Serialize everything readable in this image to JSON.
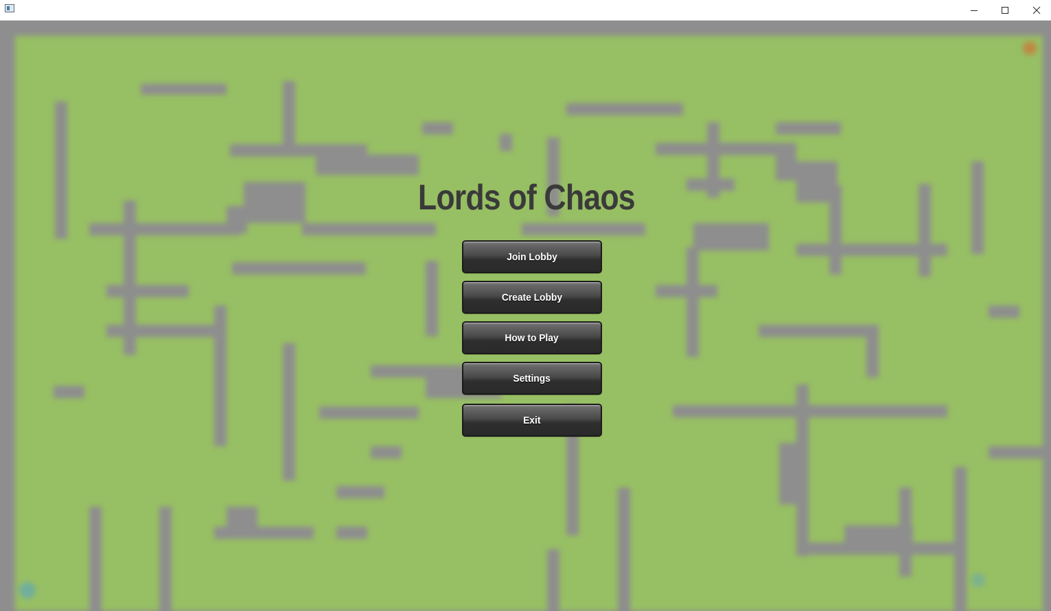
{
  "window": {
    "title": "",
    "controls": [
      "minimize-icon",
      "maximize-icon",
      "close-icon"
    ]
  },
  "game": {
    "title": "Lords of Chaos",
    "background": "blurred maze map",
    "colors": {
      "grass": "#97bf63",
      "wall": "#8e8e8e",
      "title_text": "#3a3a3a",
      "button_dark": "#2e2e2e"
    }
  },
  "menu": {
    "join_lobby": "Join Lobby",
    "create_lobby": "Create Lobby",
    "how_to_play": "How to Play",
    "settings": "Settings",
    "exit": "Exit"
  }
}
